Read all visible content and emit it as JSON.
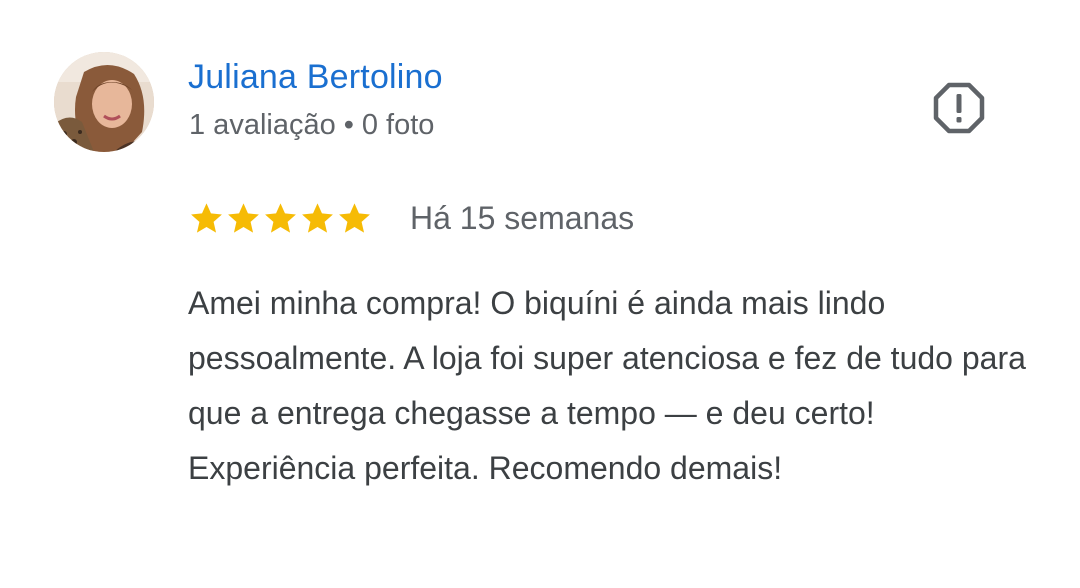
{
  "reviewer": {
    "name": "Juliana Bertolino",
    "reviews_count": "1 avaliação",
    "separator": "•",
    "photos_count": "0 foto"
  },
  "review": {
    "rating": 5,
    "rating_max": 5,
    "time_ago": "Há 15 semanas",
    "text": "Amei minha compra! O biquíni é ainda mais lindo pessoalmente. A loja foi super atenciosa e fez de tudo para que a entrega chegasse a tempo — e deu certo! Experiência perfeita. Recomendo demais!"
  },
  "icons": {
    "report": "report-flag-icon",
    "star": "star-icon"
  },
  "colors": {
    "name": "#1a6fd0",
    "star": "#f6bb05",
    "meta": "#5f6368",
    "text": "#3c4043",
    "icon": "#5f6368"
  }
}
